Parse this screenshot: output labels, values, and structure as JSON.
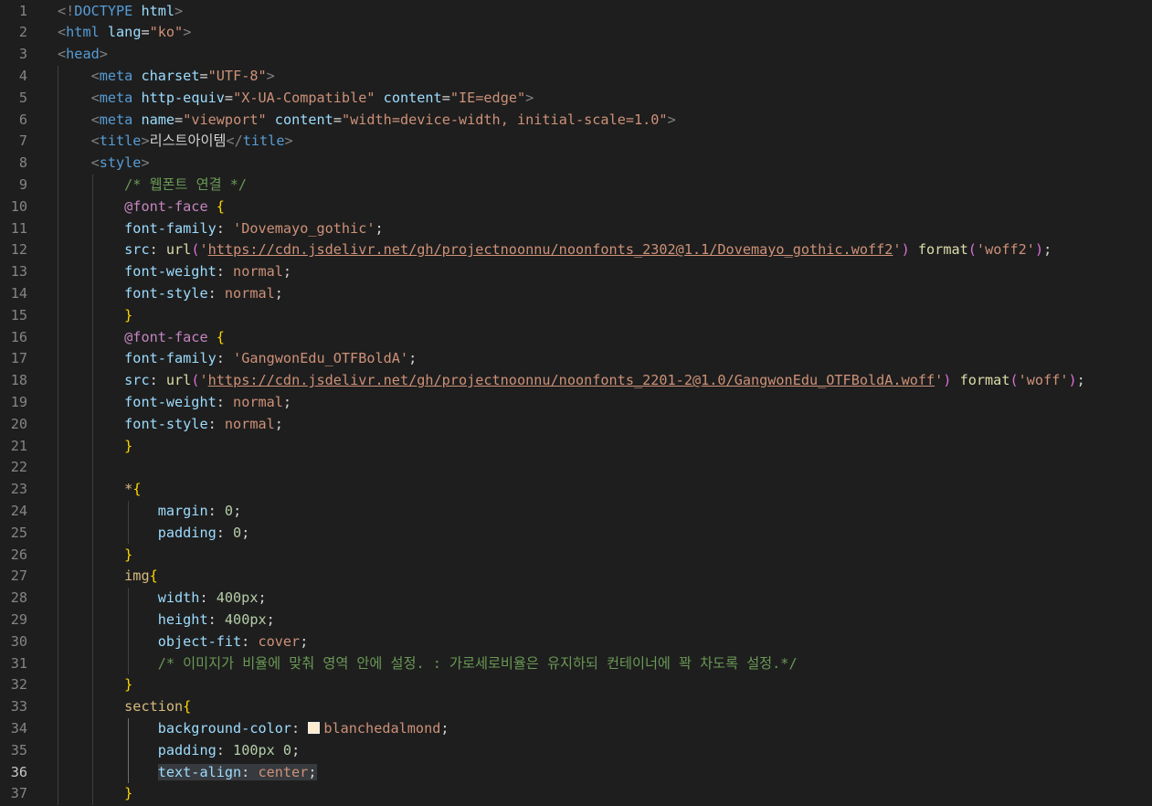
{
  "editor": {
    "theme": "dark",
    "active_line": 36,
    "swatch_color": "#ffebcd",
    "lines": [
      {
        "n": "1",
        "tokens": [
          [
            "t-punc",
            "<!"
          ],
          [
            "t-tag",
            "DOCTYPE"
          ],
          [
            "t-plain",
            " "
          ],
          [
            "t-attr",
            "html"
          ],
          [
            "t-punc",
            ">"
          ]
        ]
      },
      {
        "n": "2",
        "tokens": [
          [
            "t-punc",
            "<"
          ],
          [
            "t-tag",
            "html"
          ],
          [
            "t-plain",
            " "
          ],
          [
            "t-attr",
            "lang"
          ],
          [
            "t-plain",
            "="
          ],
          [
            "t-str",
            "\"ko\""
          ],
          [
            "t-punc",
            ">"
          ]
        ]
      },
      {
        "n": "3",
        "tokens": [
          [
            "t-punc",
            "<"
          ],
          [
            "t-tag",
            "head"
          ],
          [
            "t-punc",
            ">"
          ]
        ]
      },
      {
        "n": "4",
        "tokens": [
          [
            "t-plain",
            "    "
          ],
          [
            "t-punc",
            "<"
          ],
          [
            "t-tag",
            "meta"
          ],
          [
            "t-plain",
            " "
          ],
          [
            "t-attr",
            "charset"
          ],
          [
            "t-plain",
            "="
          ],
          [
            "t-str",
            "\"UTF-8\""
          ],
          [
            "t-punc",
            ">"
          ]
        ]
      },
      {
        "n": "5",
        "tokens": [
          [
            "t-plain",
            "    "
          ],
          [
            "t-punc",
            "<"
          ],
          [
            "t-tag",
            "meta"
          ],
          [
            "t-plain",
            " "
          ],
          [
            "t-attr",
            "http-equiv"
          ],
          [
            "t-plain",
            "="
          ],
          [
            "t-str",
            "\"X-UA-Compatible\""
          ],
          [
            "t-plain",
            " "
          ],
          [
            "t-attr",
            "content"
          ],
          [
            "t-plain",
            "="
          ],
          [
            "t-str",
            "\"IE=edge\""
          ],
          [
            "t-punc",
            ">"
          ]
        ]
      },
      {
        "n": "6",
        "tokens": [
          [
            "t-plain",
            "    "
          ],
          [
            "t-punc",
            "<"
          ],
          [
            "t-tag",
            "meta"
          ],
          [
            "t-plain",
            " "
          ],
          [
            "t-attr",
            "name"
          ],
          [
            "t-plain",
            "="
          ],
          [
            "t-str",
            "\"viewport\""
          ],
          [
            "t-plain",
            " "
          ],
          [
            "t-attr",
            "content"
          ],
          [
            "t-plain",
            "="
          ],
          [
            "t-str",
            "\"width=device-width, initial-scale=1.0\""
          ],
          [
            "t-punc",
            ">"
          ]
        ]
      },
      {
        "n": "7",
        "tokens": [
          [
            "t-plain",
            "    "
          ],
          [
            "t-punc",
            "<"
          ],
          [
            "t-tag",
            "title"
          ],
          [
            "t-punc",
            ">"
          ],
          [
            "t-text",
            "리스트아이템"
          ],
          [
            "t-punc",
            "</"
          ],
          [
            "t-tag",
            "title"
          ],
          [
            "t-punc",
            ">"
          ]
        ]
      },
      {
        "n": "8",
        "tokens": [
          [
            "t-plain",
            "    "
          ],
          [
            "t-punc",
            "<"
          ],
          [
            "t-tag",
            "style"
          ],
          [
            "t-punc",
            ">"
          ]
        ]
      },
      {
        "n": "9",
        "tokens": [
          [
            "t-plain",
            "        "
          ],
          [
            "t-com",
            "/* 웹폰트 연결 */"
          ]
        ]
      },
      {
        "n": "10",
        "tokens": [
          [
            "t-plain",
            "        "
          ],
          [
            "t-at",
            "@font-face"
          ],
          [
            "t-plain",
            " "
          ],
          [
            "t-brace",
            "{"
          ]
        ]
      },
      {
        "n": "11",
        "tokens": [
          [
            "t-plain",
            "        "
          ],
          [
            "t-prop",
            "font-family"
          ],
          [
            "t-plain",
            ": "
          ],
          [
            "t-str",
            "'Dovemayo_gothic'"
          ],
          [
            "t-plain",
            ";"
          ]
        ]
      },
      {
        "n": "12",
        "tokens": [
          [
            "t-plain",
            "        "
          ],
          [
            "t-prop",
            "src"
          ],
          [
            "t-plain",
            ": "
          ],
          [
            "t-fn",
            "url"
          ],
          [
            "t-paren",
            "("
          ],
          [
            "t-str",
            "'"
          ],
          [
            "t-url",
            "https://cdn.jsdelivr.net/gh/projectnoonnu/noonfonts_2302@1.1/Dovemayo_gothic.woff2"
          ],
          [
            "t-str",
            "'"
          ],
          [
            "t-paren",
            ")"
          ],
          [
            "t-plain",
            " "
          ],
          [
            "t-fn",
            "format"
          ],
          [
            "t-paren",
            "("
          ],
          [
            "t-str",
            "'woff2'"
          ],
          [
            "t-paren",
            ")"
          ],
          [
            "t-plain",
            ";"
          ]
        ]
      },
      {
        "n": "13",
        "tokens": [
          [
            "t-plain",
            "        "
          ],
          [
            "t-prop",
            "font-weight"
          ],
          [
            "t-plain",
            ": "
          ],
          [
            "t-val",
            "normal"
          ],
          [
            "t-plain",
            ";"
          ]
        ]
      },
      {
        "n": "14",
        "tokens": [
          [
            "t-plain",
            "        "
          ],
          [
            "t-prop",
            "font-style"
          ],
          [
            "t-plain",
            ": "
          ],
          [
            "t-val",
            "normal"
          ],
          [
            "t-plain",
            ";"
          ]
        ]
      },
      {
        "n": "15",
        "tokens": [
          [
            "t-plain",
            "        "
          ],
          [
            "t-brace",
            "}"
          ]
        ]
      },
      {
        "n": "16",
        "tokens": [
          [
            "t-plain",
            "        "
          ],
          [
            "t-at",
            "@font-face"
          ],
          [
            "t-plain",
            " "
          ],
          [
            "t-brace",
            "{"
          ]
        ]
      },
      {
        "n": "17",
        "tokens": [
          [
            "t-plain",
            "        "
          ],
          [
            "t-prop",
            "font-family"
          ],
          [
            "t-plain",
            ": "
          ],
          [
            "t-str",
            "'GangwonEdu_OTFBoldA'"
          ],
          [
            "t-plain",
            ";"
          ]
        ]
      },
      {
        "n": "18",
        "tokens": [
          [
            "t-plain",
            "        "
          ],
          [
            "t-prop",
            "src"
          ],
          [
            "t-plain",
            ": "
          ],
          [
            "t-fn",
            "url"
          ],
          [
            "t-paren",
            "("
          ],
          [
            "t-str",
            "'"
          ],
          [
            "t-url",
            "https://cdn.jsdelivr.net/gh/projectnoonnu/noonfonts_2201-2@1.0/GangwonEdu_OTFBoldA.woff"
          ],
          [
            "t-str",
            "'"
          ],
          [
            "t-paren",
            ")"
          ],
          [
            "t-plain",
            " "
          ],
          [
            "t-fn",
            "format"
          ],
          [
            "t-paren",
            "("
          ],
          [
            "t-str",
            "'woff'"
          ],
          [
            "t-paren",
            ")"
          ],
          [
            "t-plain",
            ";"
          ]
        ]
      },
      {
        "n": "19",
        "tokens": [
          [
            "t-plain",
            "        "
          ],
          [
            "t-prop",
            "font-weight"
          ],
          [
            "t-plain",
            ": "
          ],
          [
            "t-val",
            "normal"
          ],
          [
            "t-plain",
            ";"
          ]
        ]
      },
      {
        "n": "20",
        "tokens": [
          [
            "t-plain",
            "        "
          ],
          [
            "t-prop",
            "font-style"
          ],
          [
            "t-plain",
            ": "
          ],
          [
            "t-val",
            "normal"
          ],
          [
            "t-plain",
            ";"
          ]
        ]
      },
      {
        "n": "21",
        "tokens": [
          [
            "t-plain",
            "        "
          ],
          [
            "t-brace",
            "}"
          ]
        ]
      },
      {
        "n": "22",
        "tokens": []
      },
      {
        "n": "23",
        "tokens": [
          [
            "t-plain",
            "        "
          ],
          [
            "t-sel",
            "*"
          ],
          [
            "t-brace",
            "{"
          ]
        ]
      },
      {
        "n": "24",
        "tokens": [
          [
            "t-plain",
            "            "
          ],
          [
            "t-prop",
            "margin"
          ],
          [
            "t-plain",
            ": "
          ],
          [
            "t-num",
            "0"
          ],
          [
            "t-plain",
            ";"
          ]
        ]
      },
      {
        "n": "25",
        "tokens": [
          [
            "t-plain",
            "            "
          ],
          [
            "t-prop",
            "padding"
          ],
          [
            "t-plain",
            ": "
          ],
          [
            "t-num",
            "0"
          ],
          [
            "t-plain",
            ";"
          ]
        ]
      },
      {
        "n": "26",
        "tokens": [
          [
            "t-plain",
            "        "
          ],
          [
            "t-brace",
            "}"
          ]
        ]
      },
      {
        "n": "27",
        "tokens": [
          [
            "t-plain",
            "        "
          ],
          [
            "t-sel",
            "img"
          ],
          [
            "t-brace",
            "{"
          ]
        ]
      },
      {
        "n": "28",
        "tokens": [
          [
            "t-plain",
            "            "
          ],
          [
            "t-prop",
            "width"
          ],
          [
            "t-plain",
            ": "
          ],
          [
            "t-num",
            "400px"
          ],
          [
            "t-plain",
            ";"
          ]
        ]
      },
      {
        "n": "29",
        "tokens": [
          [
            "t-plain",
            "            "
          ],
          [
            "t-prop",
            "height"
          ],
          [
            "t-plain",
            ": "
          ],
          [
            "t-num",
            "400px"
          ],
          [
            "t-plain",
            ";"
          ]
        ]
      },
      {
        "n": "30",
        "tokens": [
          [
            "t-plain",
            "            "
          ],
          [
            "t-prop",
            "object-fit"
          ],
          [
            "t-plain",
            ": "
          ],
          [
            "t-val",
            "cover"
          ],
          [
            "t-plain",
            ";"
          ]
        ]
      },
      {
        "n": "31",
        "tokens": [
          [
            "t-plain",
            "            "
          ],
          [
            "t-com",
            "/* 이미지가 비율에 맞춰 영역 안에 설정. : 가로세로비율은 유지하되 컨테이너에 꽉 차도록 설정.*/"
          ]
        ]
      },
      {
        "n": "32",
        "tokens": [
          [
            "t-plain",
            "        "
          ],
          [
            "t-brace",
            "}"
          ]
        ]
      },
      {
        "n": "33",
        "tokens": [
          [
            "t-plain",
            "        "
          ],
          [
            "t-sel",
            "section"
          ],
          [
            "t-brace",
            "{"
          ]
        ]
      },
      {
        "n": "34",
        "tokens": [
          [
            "t-plain",
            "            "
          ],
          [
            "t-prop",
            "background-color"
          ],
          [
            "t-plain",
            ": "
          ],
          [
            "swatch",
            ""
          ],
          [
            "t-val",
            "blanchedalmond"
          ],
          [
            "t-plain",
            ";"
          ]
        ]
      },
      {
        "n": "35",
        "tokens": [
          [
            "t-plain",
            "            "
          ],
          [
            "t-prop",
            "padding"
          ],
          [
            "t-plain",
            ": "
          ],
          [
            "t-num",
            "100px"
          ],
          [
            "t-plain",
            " "
          ],
          [
            "t-num",
            "0"
          ],
          [
            "t-plain",
            ";"
          ]
        ]
      },
      {
        "n": "36",
        "tokens": [
          [
            "t-plain",
            "            "
          ],
          [
            "t-prop-hl",
            "text-align"
          ],
          [
            "t-plain-hl",
            ": "
          ],
          [
            "t-val-hl",
            "center"
          ],
          [
            "t-plain-hl",
            ";"
          ]
        ]
      },
      {
        "n": "37",
        "tokens": [
          [
            "t-plain",
            "        "
          ],
          [
            "t-brace",
            "}"
          ]
        ]
      }
    ]
  }
}
